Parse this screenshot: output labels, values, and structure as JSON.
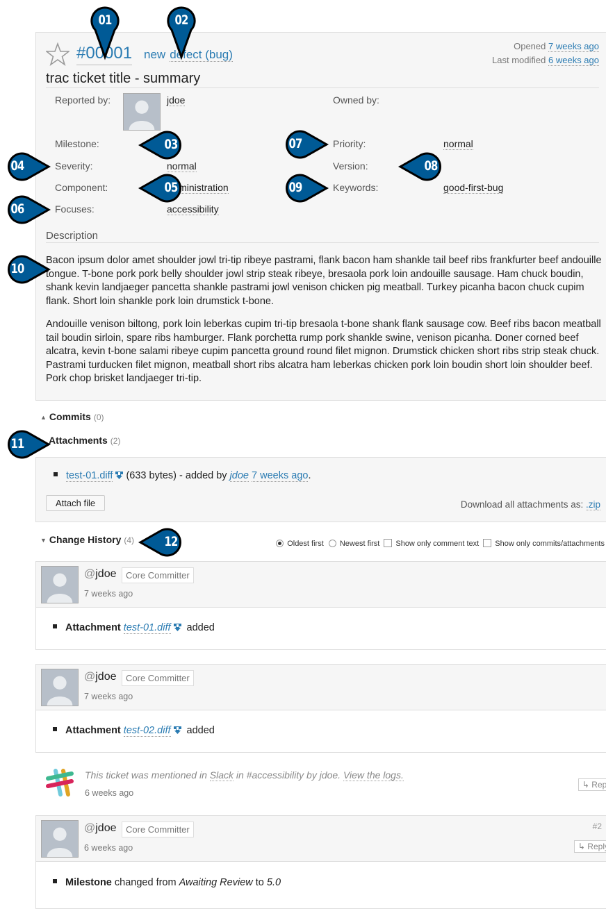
{
  "ticket": {
    "id": "#00001",
    "status": "new",
    "type": "defect (bug)",
    "opened_label": "Opened",
    "opened_ago": "7 weeks ago",
    "modified_label": "Last modified",
    "modified_ago": "6 weeks ago",
    "title": "trac ticket title - summary"
  },
  "properties": {
    "reported_by_label": "Reported by:",
    "reported_by": "jdoe",
    "owned_by_label": "Owned by:",
    "milestone_label": "Milestone:",
    "milestone": "",
    "priority_label": "Priority:",
    "priority": "normal",
    "severity_label": "Severity:",
    "severity": "normal",
    "version_label": "Version:",
    "version": "",
    "component_label": "Component:",
    "component": "Administration",
    "keywords_label": "Keywords:",
    "keywords": "good-first-bug",
    "focuses_label": "Focuses:",
    "focuses": "accessibility"
  },
  "description": {
    "title": "Description",
    "paragraphs": [
      "Bacon ipsum dolor amet shoulder jowl tri-tip ribeye pastrami, flank bacon ham shankle tail beef ribs frankfurter beef andouille tongue. T-bone pork pork belly shoulder jowl strip steak ribeye, bresaola pork loin andouille sausage. Ham chuck boudin, shank kevin landjaeger pancetta shankle pastrami jowl venison chicken pig meatball. Turkey picanha bacon chuck cupim flank. Short loin shankle pork loin drumstick t-bone.",
      "Andouille venison biltong, pork loin leberkas cupim tri-tip bresaola t-bone shank flank sausage cow. Beef ribs bacon meatball tail boudin sirloin, spare ribs hamburger. Flank porchetta rump pork shankle swine, venison picanha. Doner corned beef alcatra, kevin t-bone salami ribeye cupim pancetta ground round filet mignon. Drumstick chicken short ribs strip steak chuck. Pastrami turducken filet mignon, meatball short ribs alcatra ham leberkas chicken pork loin boudin short loin shoulder beef. Pork chop brisket landjaeger tri-tip."
    ]
  },
  "commits": {
    "label": "Commits",
    "count": "(0)"
  },
  "attachments": {
    "label": "Attachments",
    "count": "(2)",
    "item": {
      "filename": "test-01.diff",
      "size": "(633 bytes) - added by",
      "author": "jdoe",
      "ago": "7 weeks ago",
      "end": "."
    },
    "attach_button": "Attach file",
    "download_all_label": "Download all attachments as:",
    "download_all_link": ".zip"
  },
  "history": {
    "label": "Change History",
    "count": "(4)",
    "options": {
      "oldest": "Oldest first",
      "newest": "Newest first",
      "comment_only": "Show only comment text",
      "commits_only": "Show only commits/attachments"
    },
    "changes": [
      {
        "at": "@",
        "user": "jdoe",
        "role": "Core Committer",
        "ago": "7 weeks ago",
        "field": "Attachment",
        "link": "test-01.diff",
        "suffix": "added"
      },
      {
        "at": "@",
        "user": "jdoe",
        "role": "Core Committer",
        "ago": "7 weeks ago",
        "field": "Attachment",
        "link": "test-02.diff",
        "suffix": "added"
      }
    ],
    "slack": {
      "text1": "This ticket was mentioned in",
      "slack_link": "Slack",
      "text2": "in #accessibility by jdoe.",
      "logs_link": "View the logs.",
      "ago": "6 weeks ago",
      "reply": "↳ Reply"
    },
    "comment2": {
      "at": "@",
      "user": "jdoe",
      "role": "Core Committer",
      "ago": "6 weeks ago",
      "number": "#2",
      "reply": "↳ Reply",
      "field": "Milestone",
      "text1": "changed from",
      "from": "Awaiting Review",
      "text2": "to",
      "to": "5.0"
    }
  },
  "callouts": [
    "01",
    "02",
    "03",
    "04",
    "05",
    "06",
    "07",
    "08",
    "09",
    "10",
    "11",
    "12"
  ],
  "colors": {
    "callout_fill": "#005a96",
    "callout_outline": "#000000",
    "link": "#2a7bb2"
  }
}
